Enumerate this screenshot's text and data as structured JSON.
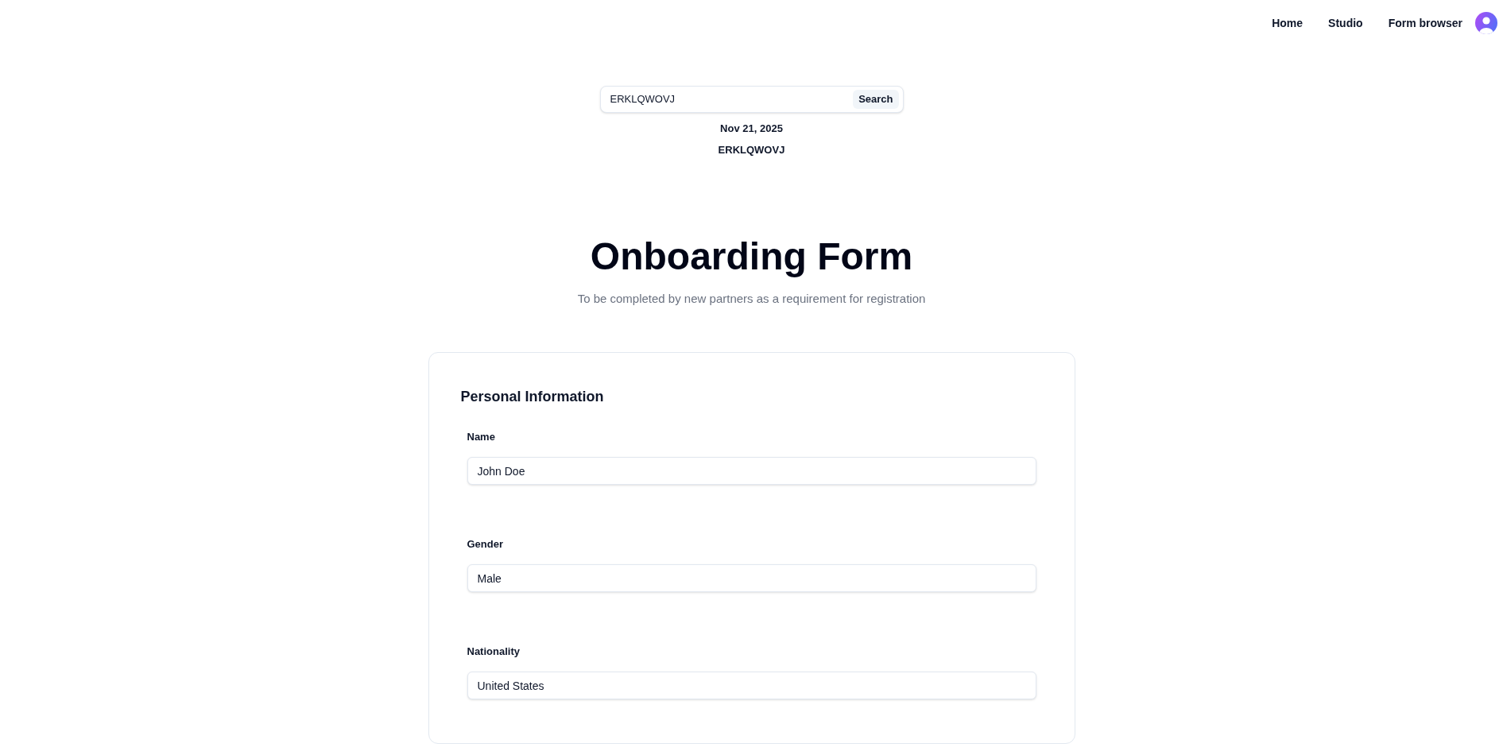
{
  "nav": {
    "links": [
      "Home",
      "Studio",
      "Form browser"
    ]
  },
  "search": {
    "value": "ERKLQWOVJ",
    "button": "Search"
  },
  "record": {
    "date": "Nov 21, 2025",
    "code": "ERKLQWOVJ"
  },
  "form": {
    "title": "Onboarding Form",
    "subtitle": "To be completed by new partners as a requirement for registration",
    "sections": [
      {
        "title": "Personal Information",
        "fields": [
          {
            "label": "Name",
            "value": "John Doe"
          },
          {
            "label": "Gender",
            "value": "Male"
          },
          {
            "label": "Nationality",
            "value": "United States"
          }
        ]
      }
    ]
  }
}
